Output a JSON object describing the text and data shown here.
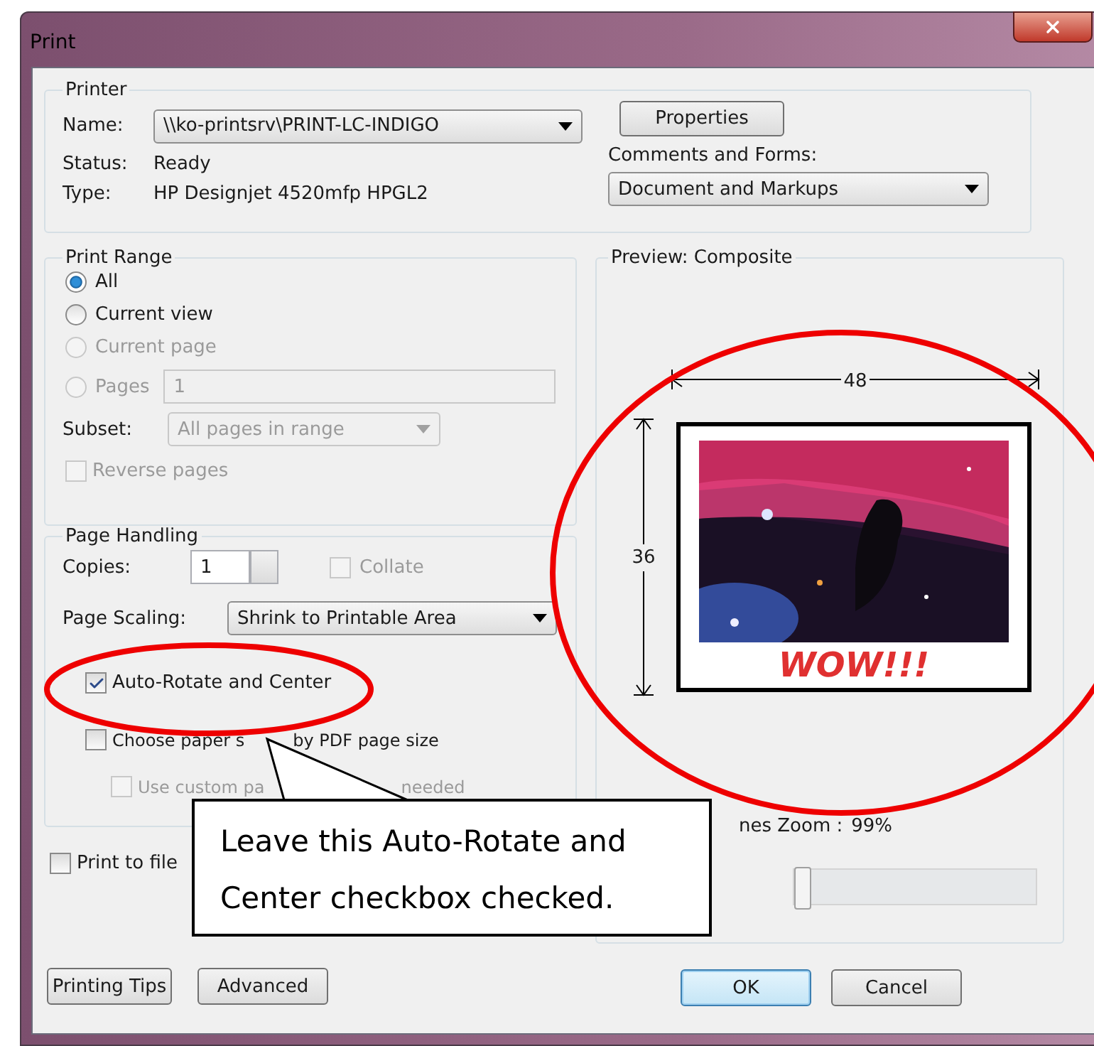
{
  "window": {
    "title": "Print"
  },
  "printer": {
    "legend": "Printer",
    "name_label": "Name:",
    "name_value": "\\\\ko-printsrv\\PRINT-LC-INDIGO",
    "status_label": "Status:",
    "status_value": "Ready",
    "type_label": "Type:",
    "type_value": "HP Designjet 4520mfp HPGL2",
    "properties_button": "Properties",
    "comments_label": "Comments and Forms:",
    "comments_value": "Document and Markups"
  },
  "print_range": {
    "legend": "Print Range",
    "options": [
      {
        "label": "All",
        "selected": true,
        "disabled": false
      },
      {
        "label": "Current view",
        "selected": false,
        "disabled": false
      },
      {
        "label": "Current page",
        "selected": false,
        "disabled": true
      },
      {
        "label": "Pages",
        "selected": false,
        "disabled": true
      }
    ],
    "pages_value": "1",
    "subset_label": "Subset:",
    "subset_value": "All pages in range",
    "reverse": {
      "label": "Reverse pages",
      "checked": false,
      "disabled": true
    }
  },
  "page_handling": {
    "legend": "Page Handling",
    "copies_label": "Copies:",
    "copies_value": "1",
    "collate": {
      "label": "Collate",
      "checked": false,
      "disabled": true
    },
    "scaling_label": "Page Scaling:",
    "scaling_value": "Shrink to Printable Area",
    "options": [
      {
        "parts": [
          "Auto-Rotate and Center"
        ],
        "checked": true,
        "disabled": false
      },
      {
        "parts": [
          "Choose paper s",
          "by PDF page size"
        ],
        "checked": false,
        "disabled": false,
        "children": [
          {
            "parts": [
              "Use custom pa",
              "needed"
            ],
            "checked": false,
            "disabled": true
          }
        ]
      }
    ]
  },
  "print_to_file": {
    "label": "Print to file",
    "checked": false
  },
  "preview": {
    "legend": "Preview: Composite",
    "width_label": "48",
    "height_label": "36",
    "caption": "WOW!!!",
    "zoom_label": "nes Zoom :",
    "zoom_value": "99%",
    "zoom_slider": {
      "level": 0
    }
  },
  "left_buttons": [
    "Printing Tips",
    "Advanced"
  ],
  "right_buttons": [
    {
      "label": "OK",
      "selected": true
    },
    {
      "label": "Cancel",
      "selected": false
    }
  ],
  "callout": {
    "text": "Leave this Auto-Rotate and Center checkbox checked."
  }
}
